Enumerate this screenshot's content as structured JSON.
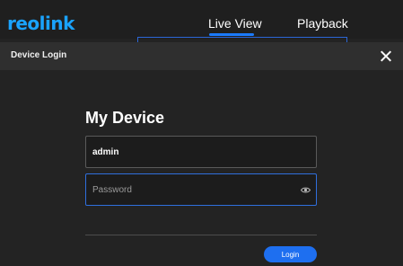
{
  "app": {
    "brand": "reolink",
    "brand_color": "#1aa3ff"
  },
  "nav": {
    "tabs": [
      {
        "label": "Live View",
        "active": true
      },
      {
        "label": "Playback",
        "active": false
      }
    ],
    "accent": "#1b7bff"
  },
  "dialog": {
    "title": "Device Login",
    "close_icon": "close-icon",
    "device_name": "My Device",
    "username": {
      "value": "admin"
    },
    "password": {
      "value": "",
      "placeholder": "Password",
      "toggle_icon": "eye-icon"
    },
    "login_label": "Login",
    "login_color": "#1e6ff0"
  }
}
